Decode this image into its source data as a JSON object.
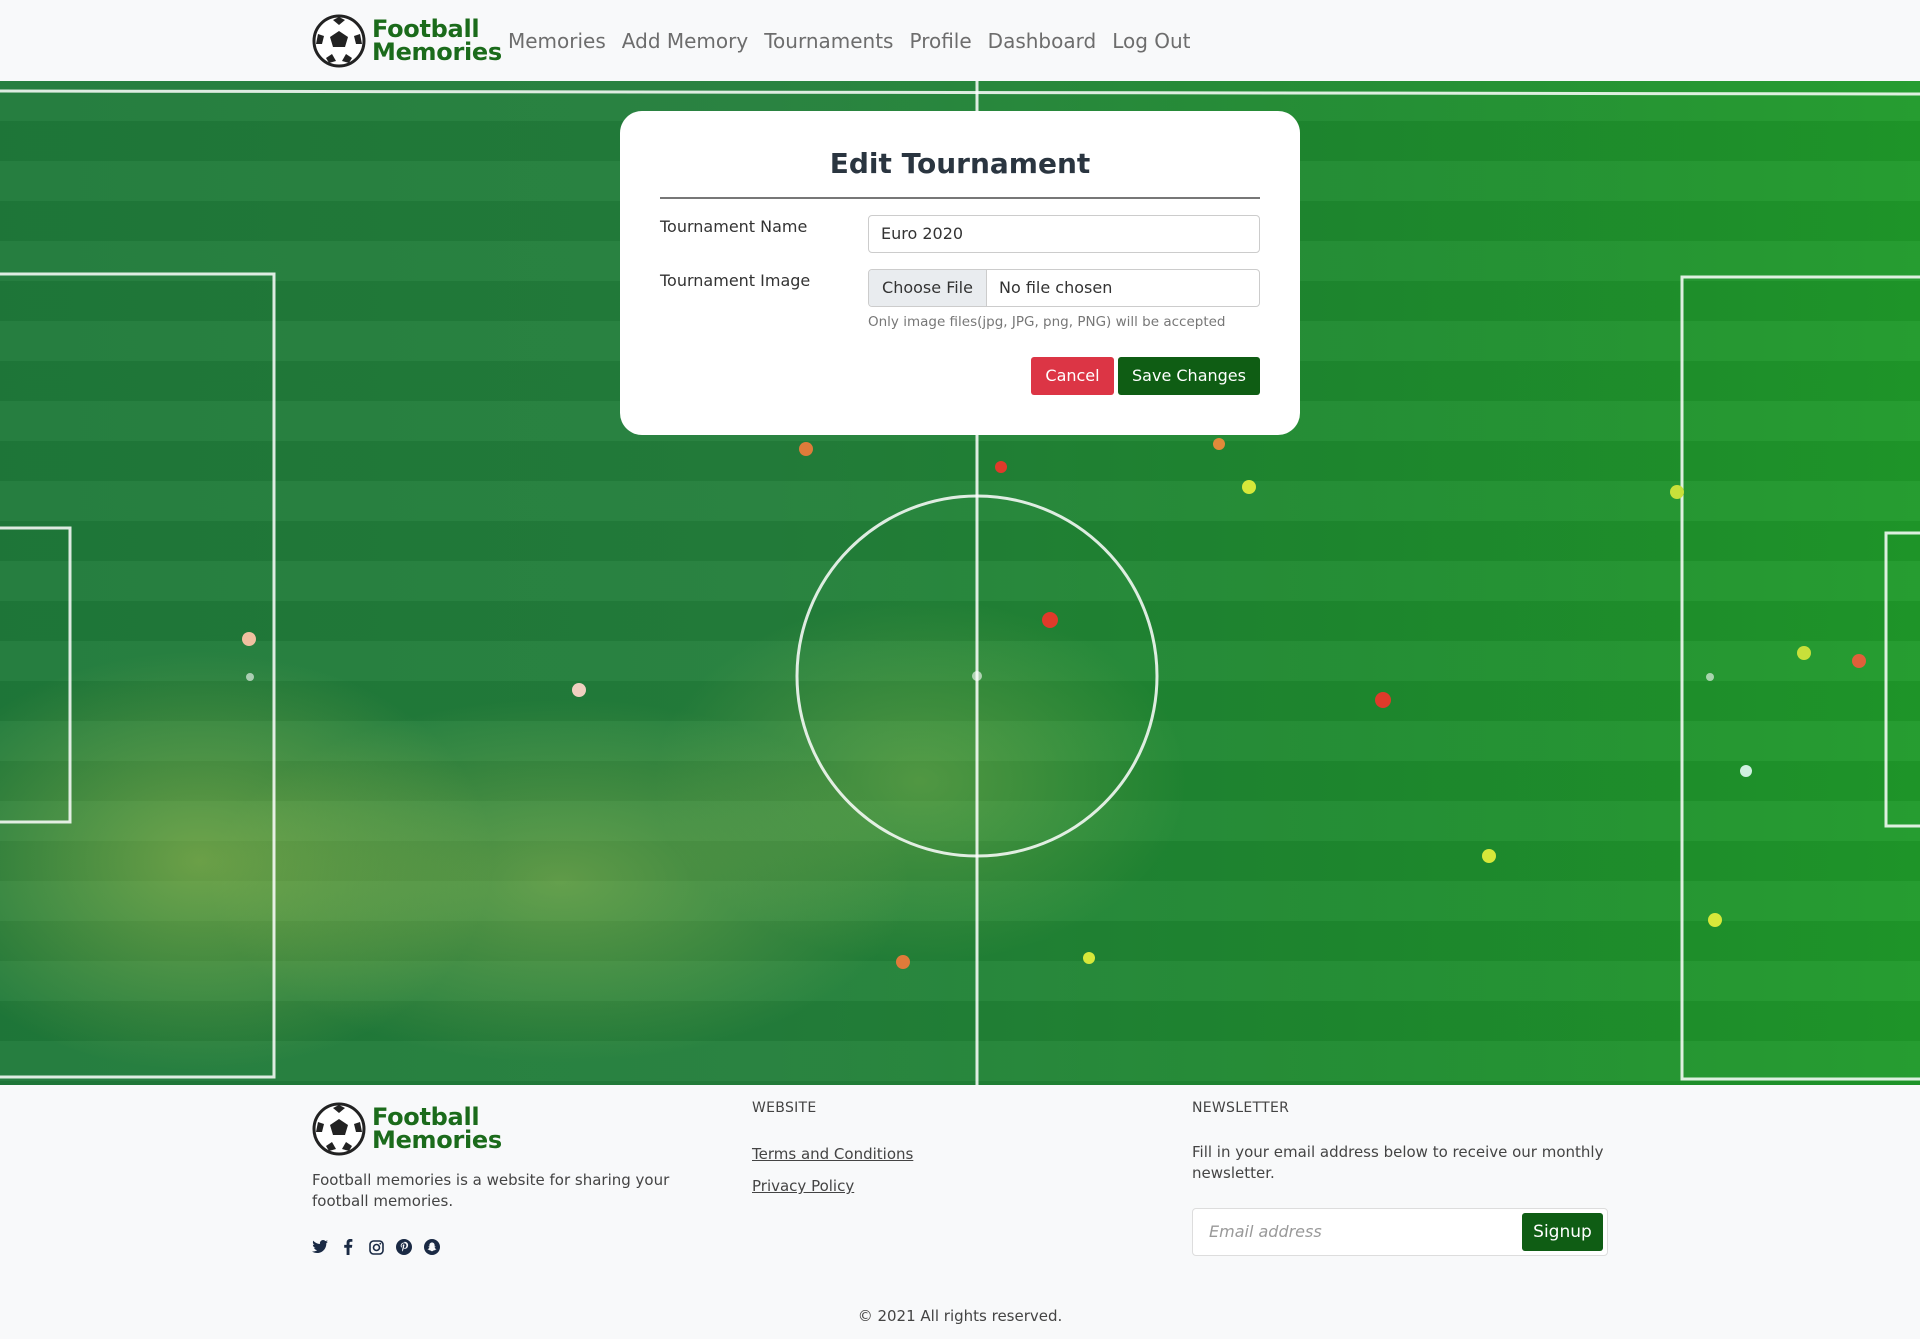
{
  "brand": {
    "line1": "Football",
    "line2": "Memories"
  },
  "nav": [
    {
      "label": "Memories"
    },
    {
      "label": "Add Memory"
    },
    {
      "label": "Tournaments"
    },
    {
      "label": "Profile"
    },
    {
      "label": "Dashboard"
    },
    {
      "label": "Log Out"
    }
  ],
  "form": {
    "title": "Edit Tournament",
    "name_label": "Tournament Name",
    "name_value": "Euro 2020",
    "image_label": "Tournament Image",
    "file_button": "Choose File",
    "file_status": "No file chosen",
    "hint": "Only image files(jpg, JPG, png, PNG) will be accepted",
    "cancel_label": "Cancel",
    "save_label": "Save Changes"
  },
  "footer": {
    "description": "Football memories is a website for sharing your football memories.",
    "social_icons": [
      "twitter-icon",
      "facebook-icon",
      "instagram-icon",
      "pinterest-icon",
      "snapchat-icon"
    ],
    "website_heading": "WEBSITE",
    "links": [
      {
        "label": "Terms and Conditions"
      },
      {
        "label": "Privacy Policy"
      }
    ],
    "newsletter_heading": "NEWSLETTER",
    "newsletter_text": "Fill in your email address below to receive our monthly newsletter.",
    "email_placeholder": "Email address",
    "signup_label": "Signup",
    "copyright": "© 2021 All rights reserved."
  },
  "colors": {
    "brand_green": "#1b6b1b",
    "button_green": "#0f5d14",
    "cancel_red": "#dc3545",
    "pitch_green": "#1f8a30"
  }
}
